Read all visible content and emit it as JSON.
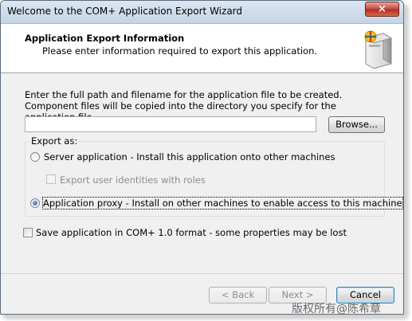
{
  "window": {
    "title": "Welcome to the COM+ Application Export Wizard",
    "close_glyph": "×"
  },
  "header": {
    "title": "Application Export Information",
    "subtitle": "Please enter information required to export this application.",
    "icon": "com-package-icon"
  },
  "form": {
    "instructions": "Enter the full path and filename for the application file to be created.  Component files will be copied into the directory you specify for the application file.",
    "path_value": "",
    "browse_label": "Browse..."
  },
  "export_as": {
    "label": "Export as:",
    "server_option": "Server application - Install this application onto other machines",
    "server_selected": false,
    "export_identities": "Export user identities with roles",
    "export_identities_checked": false,
    "export_identities_enabled": false,
    "proxy_option": "Application proxy - Install on other machines to enable access to this machine",
    "proxy_selected": true
  },
  "save_com10": {
    "label": "Save application in COM+ 1.0 format - some properties may be lost",
    "checked": false
  },
  "buttons": {
    "back": "< Back",
    "next": "Next >",
    "cancel": "Cancel"
  },
  "watermark": "版权所有@陈希章",
  "colors": {
    "window_bg": "#f0f0f0",
    "header_bg": "#ffffff",
    "close_red": "#c75050"
  }
}
